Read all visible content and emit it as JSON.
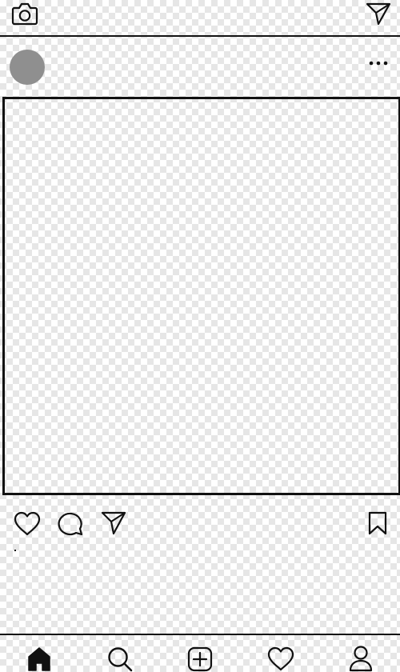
{
  "header": {
    "camera_icon": "camera-icon",
    "direct_icon": "paper-plane-icon"
  },
  "post": {
    "avatar_color": "#8f8f8f",
    "more_icon": "more-options-icon",
    "actions": [
      "heart-icon",
      "comment-icon",
      "paper-plane-icon",
      "bookmark-icon"
    ]
  },
  "bottom_nav": {
    "items": [
      "home-icon",
      "search-icon",
      "add-post-icon",
      "heart-icon",
      "profile-icon"
    ],
    "active": "home-icon"
  },
  "colors": {
    "stroke": "#111111",
    "checker": "#e6e6e6"
  }
}
